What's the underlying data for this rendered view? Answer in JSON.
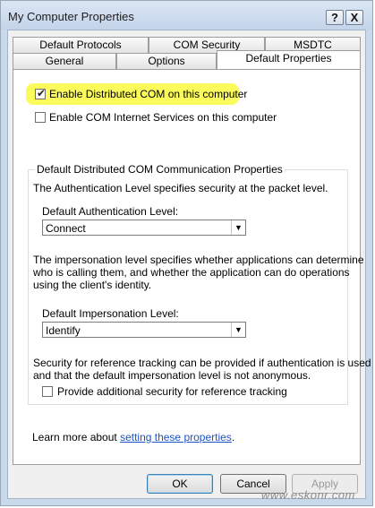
{
  "window": {
    "title": "My Computer Properties",
    "help_glyph": "?",
    "close_glyph": "X"
  },
  "tabs_back": [
    "Default Protocols",
    "COM Security",
    "MSDTC"
  ],
  "tabs_front": [
    "General",
    "Options",
    "Default Properties"
  ],
  "active_tab": "Default Properties",
  "options": {
    "enable_dcom": {
      "label": "Enable Distributed COM on this computer",
      "checked": true,
      "check_glyph": "✔"
    },
    "enable_cis": {
      "label": "Enable COM Internet Services on this computer",
      "checked": false
    }
  },
  "group": {
    "legend": "Default Distributed COM Communication Properties",
    "auth_desc": "The Authentication Level specifies security at the packet level.",
    "auth_label": "Default Authentication Level:",
    "auth_value": "Connect",
    "imp_desc_1": "The impersonation level specifies whether applications can determine",
    "imp_desc_2": "who is calling them, and whether the application can do operations",
    "imp_desc_3": "using the client's identity.",
    "imp_label": "Default Impersonation Level:",
    "imp_value": "Identify",
    "ref_desc_1": "Security for reference tracking can be provided if authentication is used",
    "ref_desc_2": "and that the default impersonation level is not anonymous.",
    "ref_option": {
      "label": "Provide additional security for reference tracking",
      "checked": false
    }
  },
  "learn_more": {
    "prefix": "Learn more about ",
    "link": "setting these properties",
    "suffix": "."
  },
  "buttons": {
    "ok": "OK",
    "cancel": "Cancel",
    "apply": "Apply"
  },
  "watermark": "www.eskonr.com",
  "colors": {
    "highlight": "#fbfc5b",
    "link": "#1a53c8"
  },
  "icons": {
    "dropdown": "▼"
  }
}
